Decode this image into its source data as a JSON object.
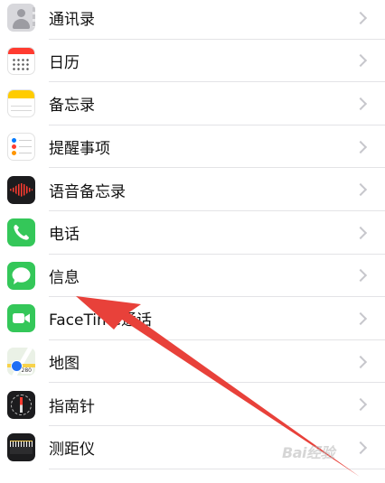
{
  "settings_list": {
    "items": [
      {
        "label": "通讯录",
        "icon": "contacts-icon"
      },
      {
        "label": "日历",
        "icon": "calendar-icon"
      },
      {
        "label": "备忘录",
        "icon": "notes-icon"
      },
      {
        "label": "提醒事项",
        "icon": "reminders-icon"
      },
      {
        "label": "语音备忘录",
        "icon": "voice-memos-icon"
      },
      {
        "label": "电话",
        "icon": "phone-icon"
      },
      {
        "label": "信息",
        "icon": "messages-icon"
      },
      {
        "label": "FaceTime通话",
        "icon": "facetime-icon"
      },
      {
        "label": "地图",
        "icon": "maps-icon"
      },
      {
        "label": "指南针",
        "icon": "compass-icon"
      },
      {
        "label": "测距仪",
        "icon": "measure-icon"
      }
    ]
  },
  "maps_icon_shield": "280",
  "annotation": {
    "arrow_color": "#e8413a",
    "points_to": "信息"
  },
  "watermark": "Bai经验"
}
